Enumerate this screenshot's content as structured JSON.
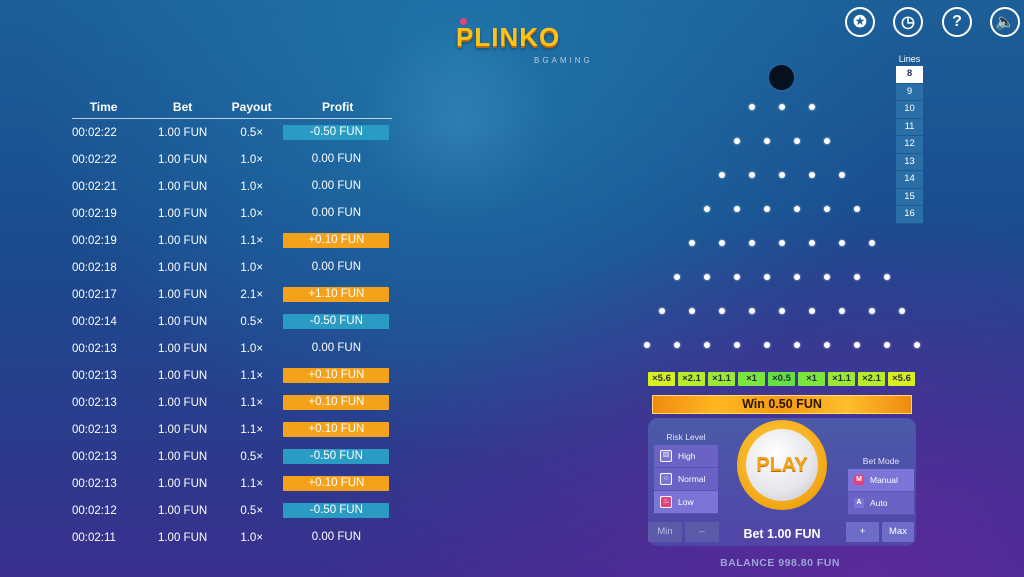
{
  "logo": {
    "title": "PLINKO",
    "subtitle": "BGAMING"
  },
  "top_icons": [
    {
      "name": "hotkeys-icon",
      "glyph": "✪"
    },
    {
      "name": "history-icon",
      "glyph": "◷"
    },
    {
      "name": "help-icon",
      "glyph": "?"
    },
    {
      "name": "sound-icon",
      "glyph": "🔈"
    }
  ],
  "history": {
    "headers": [
      "Time",
      "Bet",
      "Payout",
      "Profit"
    ],
    "rows": [
      {
        "time": "00:02:22",
        "bet": "1.00 FUN",
        "payout": "0.5×",
        "profit": "-0.50 FUN",
        "kind": "neg"
      },
      {
        "time": "00:02:22",
        "bet": "1.00 FUN",
        "payout": "1.0×",
        "profit": "0.00 FUN",
        "kind": "zero"
      },
      {
        "time": "00:02:21",
        "bet": "1.00 FUN",
        "payout": "1.0×",
        "profit": "0.00 FUN",
        "kind": "zero"
      },
      {
        "time": "00:02:19",
        "bet": "1.00 FUN",
        "payout": "1.0×",
        "profit": "0.00 FUN",
        "kind": "zero"
      },
      {
        "time": "00:02:19",
        "bet": "1.00 FUN",
        "payout": "1.1×",
        "profit": "+0.10 FUN",
        "kind": "pos"
      },
      {
        "time": "00:02:18",
        "bet": "1.00 FUN",
        "payout": "1.0×",
        "profit": "0.00 FUN",
        "kind": "zero"
      },
      {
        "time": "00:02:17",
        "bet": "1.00 FUN",
        "payout": "2.1×",
        "profit": "+1.10 FUN",
        "kind": "pos"
      },
      {
        "time": "00:02:14",
        "bet": "1.00 FUN",
        "payout": "0.5×",
        "profit": "-0.50 FUN",
        "kind": "neg"
      },
      {
        "time": "00:02:13",
        "bet": "1.00 FUN",
        "payout": "1.0×",
        "profit": "0.00 FUN",
        "kind": "zero"
      },
      {
        "time": "00:02:13",
        "bet": "1.00 FUN",
        "payout": "1.1×",
        "profit": "+0.10 FUN",
        "kind": "pos"
      },
      {
        "time": "00:02:13",
        "bet": "1.00 FUN",
        "payout": "1.1×",
        "profit": "+0.10 FUN",
        "kind": "pos"
      },
      {
        "time": "00:02:13",
        "bet": "1.00 FUN",
        "payout": "1.1×",
        "profit": "+0.10 FUN",
        "kind": "pos"
      },
      {
        "time": "00:02:13",
        "bet": "1.00 FUN",
        "payout": "0.5×",
        "profit": "-0.50 FUN",
        "kind": "neg"
      },
      {
        "time": "00:02:13",
        "bet": "1.00 FUN",
        "payout": "1.1×",
        "profit": "+0.10 FUN",
        "kind": "pos"
      },
      {
        "time": "00:02:12",
        "bet": "1.00 FUN",
        "payout": "0.5×",
        "profit": "-0.50 FUN",
        "kind": "neg"
      },
      {
        "time": "00:02:11",
        "bet": "1.00 FUN",
        "payout": "1.0×",
        "profit": "0.00 FUN",
        "kind": "zero"
      }
    ]
  },
  "lines": {
    "label": "Lines",
    "options": [
      "8",
      "9",
      "10",
      "11",
      "12",
      "13",
      "14",
      "15",
      "16"
    ],
    "selected": "8"
  },
  "multipliers": [
    {
      "label": "×5.6",
      "color": "#d9f020"
    },
    {
      "label": "×2.1",
      "color": "#b8ec2a"
    },
    {
      "label": "×1.1",
      "color": "#9ce838"
    },
    {
      "label": "×1",
      "color": "#7ce43e"
    },
    {
      "label": "×0.5",
      "color": "#62e046"
    },
    {
      "label": "×1",
      "color": "#7ce43e"
    },
    {
      "label": "×1.1",
      "color": "#9ce838"
    },
    {
      "label": "×2.1",
      "color": "#b8ec2a"
    },
    {
      "label": "×5.6",
      "color": "#d9f020"
    }
  ],
  "win_text": "Win 0.50 FUN",
  "risk": {
    "label": "Risk Level",
    "options": [
      {
        "label": "High",
        "icon": "dice-icon",
        "color": "#7c74d6"
      },
      {
        "label": "Normal",
        "icon": "ring-icon",
        "color": "#7c74d6"
      },
      {
        "label": "Low",
        "icon": "flame-icon",
        "color": "#e0427a"
      }
    ]
  },
  "play_label": "PLAY",
  "bet_mode": {
    "label": "Bet Mode",
    "options": [
      {
        "key": "M",
        "label": "Manual",
        "color": "#e0427a"
      },
      {
        "key": "A",
        "label": "Auto",
        "color": "#7c74d6"
      }
    ]
  },
  "bet": {
    "min_label": "Min",
    "minus_label": "–",
    "text": "Bet 1.00 FUN",
    "plus_label": "+",
    "max_label": "Max"
  },
  "balance": "BALANCE 998.80 FUN"
}
